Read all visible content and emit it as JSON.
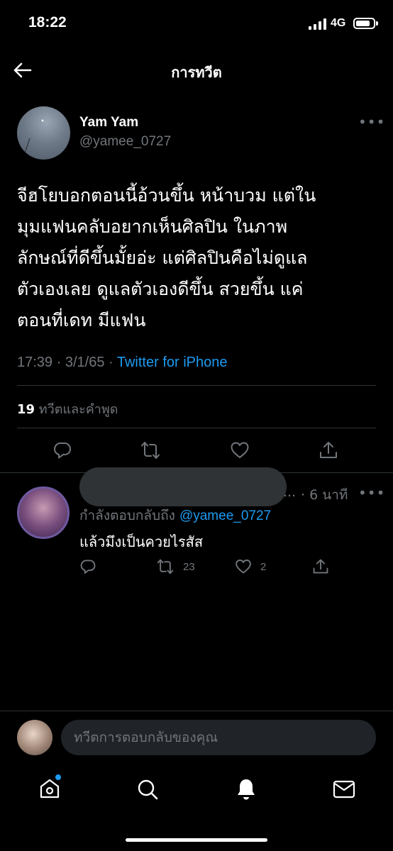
{
  "status_bar": {
    "time": "18:22",
    "network": "4G"
  },
  "header": {
    "title": "การทวีต"
  },
  "tweet": {
    "author_name": "Yam Yam",
    "author_handle": "@yamee_0727",
    "text_lines": [
      "จีฮโยบอกตอนนี้อ้วนขึ้น หน้าบวม แต่ใน",
      "มุมแฟนคลับอยากเห็นศิลปิน ในภาพ",
      "ลักษณ์ที่ดีขึ้นมั้ยอ่ะ แต่ศิลปินคือไม่ดูแล",
      "ตัวเองเลย ดูแลตัวเองดีขึ้น สวยขึ้น แค่",
      "ตอนที่เดท มีแฟน"
    ],
    "time": "17:39",
    "date": "3/1/65",
    "source": "Twitter for iPhone",
    "quote_count": "19",
    "quote_label": "ทวีตและคำพูด"
  },
  "reply": {
    "ellipsis": "...",
    "time": "· 6 นาที",
    "replying_to_label": "กำลังตอบกลับถึง",
    "replying_to_handle": "@yamee_0727",
    "text": "แล้วมึงเป็นควยไรสัส",
    "retweet_count": "23",
    "like_count": "2"
  },
  "compose": {
    "placeholder": "ทวีตการตอบกลับของคุณ"
  },
  "colors": {
    "accent": "#1d9bf0",
    "secondary_text": "#71767b",
    "divider": "#2f3336"
  }
}
